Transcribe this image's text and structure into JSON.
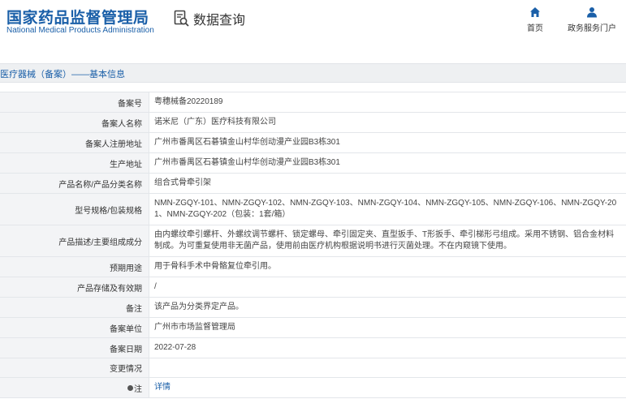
{
  "header": {
    "brand_cn": "国家药品监督管理局",
    "brand_en": "National Medical Products Administration",
    "query_label": "数据查询",
    "nav": [
      {
        "label": "首页",
        "icon": "home-icon"
      },
      {
        "label": "政务服务门户",
        "icon": "user-icon"
      }
    ]
  },
  "section": {
    "title": "医疗器械（备案）——基本信息"
  },
  "rows": [
    {
      "label": "备案号",
      "value": "粤穗械备20220189"
    },
    {
      "label": "备案人名称",
      "value": "诺米尼（广东）医疗科技有限公司"
    },
    {
      "label": "备案人注册地址",
      "value": "广州市番禺区石碁镇金山村华创动漫产业园B3栋301"
    },
    {
      "label": "生产地址",
      "value": "广州市番禺区石碁镇金山村华创动漫产业园B3栋301"
    },
    {
      "label": "产品名称/产品分类名称",
      "value": "组合式骨牵引架"
    },
    {
      "label": "型号规格/包装规格",
      "value": "NMN-ZGQY-101、NMN-ZGQY-102、NMN-ZGQY-103、NMN-ZGQY-104、NMN-ZGQY-105、NMN-ZGQY-106、NMN-ZGQY-201、NMN-ZGQY-202（包装：1套/箱）"
    },
    {
      "label": "产品描述/主要组成成分",
      "value": "由内螺纹牵引螺杆、外螺纹调节螺杆、锁定螺母、牵引固定夹、直型扳手、T形扳手、牵引梯形弓组成。采用不锈钢、铝合金材料制成。为可重复使用非无菌产品，使用前由医疗机构根据说明书进行灭菌处理。不在内窥镜下使用。"
    },
    {
      "label": "预期用途",
      "value": "用于骨科手术中骨骼复位牵引用。"
    },
    {
      "label": "产品存储及有效期",
      "value": "/"
    },
    {
      "label": "备注",
      "value": "该产品为分类界定产品。"
    },
    {
      "label": "备案单位",
      "value": "广州市市场监督管理局"
    },
    {
      "label": "备案日期",
      "value": "2022-07-28"
    },
    {
      "label": "变更情况",
      "value": ""
    },
    {
      "label": "注",
      "value": "详情"
    }
  ],
  "colors": {
    "brand_blue": "#1a5fa8",
    "label_bg": "#f3f4f6",
    "section_bg": "#eef0f2"
  }
}
